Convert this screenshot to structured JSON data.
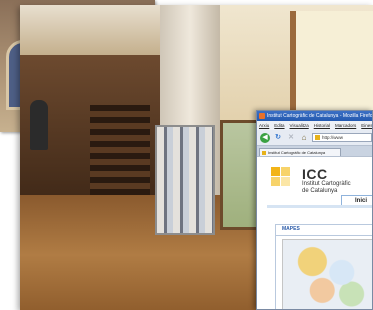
{
  "scene": {
    "facade_photo_alt": "",
    "interior_photo_alt": ""
  },
  "browser": {
    "window_title": "Institut Cartogràfic de Catalunya - Mozilla Firefox",
    "menu": [
      "Arxiu",
      "Edita",
      "Visualitza",
      "Historial",
      "Marcadors",
      "Eines"
    ],
    "url": "http://www",
    "tab_label": "Institut Cartogràfic de Catalunya",
    "page": {
      "logo_acronym": "ICC",
      "logo_line1": "Institut Cartogràfic",
      "logo_line2": "de Catalunya",
      "active_tab": "Inici",
      "panel_title": "MAPES"
    }
  },
  "colors": {
    "titlebar": "#245ab0",
    "logo_yellow": "#f2b418",
    "panel_border": "#b9c9de"
  }
}
